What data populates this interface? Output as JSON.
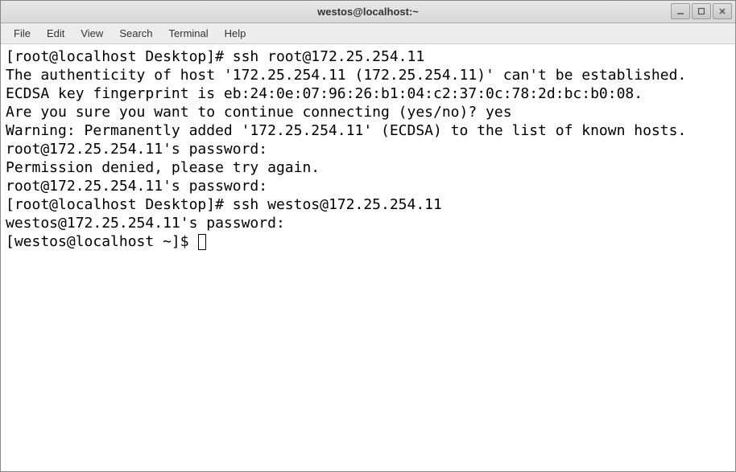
{
  "window": {
    "title": "westos@localhost:~"
  },
  "menubar": {
    "items": [
      "File",
      "Edit",
      "View",
      "Search",
      "Terminal",
      "Help"
    ]
  },
  "terminal": {
    "lines": [
      "[root@localhost Desktop]# ssh root@172.25.254.11",
      "The authenticity of host '172.25.254.11 (172.25.254.11)' can't be established.",
      "ECDSA key fingerprint is eb:24:0e:07:96:26:b1:04:c2:37:0c:78:2d:bc:b0:08.",
      "Are you sure you want to continue connecting (yes/no)? yes",
      "Warning: Permanently added '172.25.254.11' (ECDSA) to the list of known hosts.",
      "root@172.25.254.11's password: ",
      "Permission denied, please try again.",
      "root@172.25.254.11's password: ",
      "",
      "[root@localhost Desktop]# ssh westos@172.25.254.11",
      "westos@172.25.254.11's password: ",
      "[westos@localhost ~]$ "
    ]
  }
}
